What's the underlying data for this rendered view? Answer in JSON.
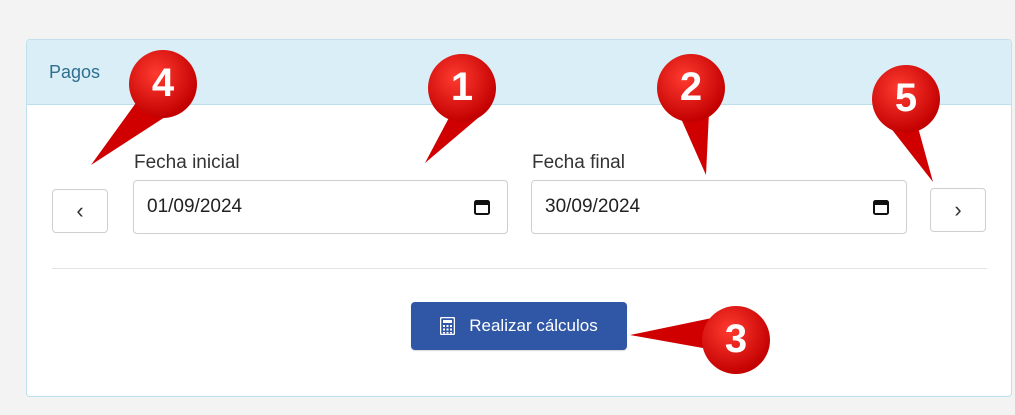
{
  "panel": {
    "title": "Pagos",
    "fields": {
      "start": {
        "label": "Fecha inicial",
        "value": "01/09/2024"
      },
      "end": {
        "label": "Fecha final",
        "value": "30/09/2024"
      }
    },
    "prev_button": "‹",
    "next_button": "›",
    "calculate_button": {
      "label": "Realizar cálculos"
    }
  },
  "annotations": {
    "items": [
      {
        "number": "1"
      },
      {
        "number": "2"
      },
      {
        "number": "3"
      },
      {
        "number": "4"
      },
      {
        "number": "5"
      }
    ],
    "color": "#d00000"
  }
}
